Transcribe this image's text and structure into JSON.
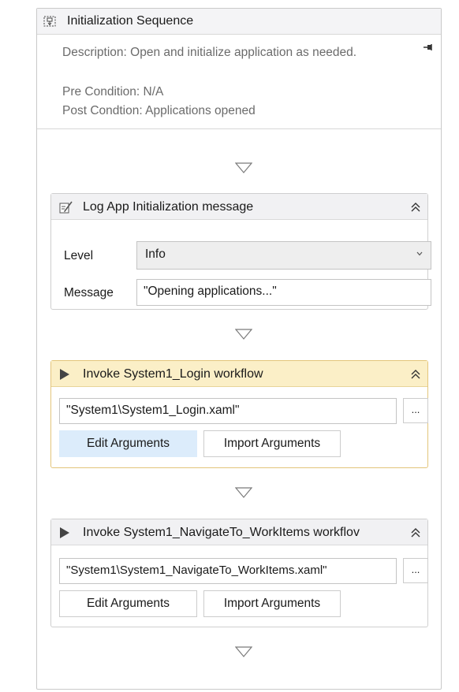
{
  "sequence": {
    "title": "Initialization Sequence",
    "annotation": {
      "description": "Description: Open and initialize application as needed.",
      "pre_condition": "Pre Condition: N/A",
      "post_condition": "Post Condtion: Applications opened"
    }
  },
  "log_activity": {
    "title": "Log App Initialization message",
    "level_label": "Level",
    "level_value": "Info",
    "message_label": "Message",
    "message_value": "\"Opening applications...\""
  },
  "invoke_login": {
    "title": "Invoke System1_Login workflow",
    "file_path": "\"System1\\System1_Login.xaml\"",
    "ellipsis": "...",
    "edit_arguments": "Edit Arguments",
    "import_arguments": "Import Arguments"
  },
  "invoke_navigate": {
    "title": "Invoke System1_NavigateTo_WorkItems workflov",
    "file_path": "\"System1\\System1_NavigateTo_WorkItems.xaml\"",
    "ellipsis": "...",
    "edit_arguments": "Edit Arguments",
    "import_arguments": "Import Arguments"
  },
  "colors": {
    "selected_header": "#fbefc7",
    "selected_border": "#e3c57a",
    "hover_button": "#dcecfb"
  }
}
